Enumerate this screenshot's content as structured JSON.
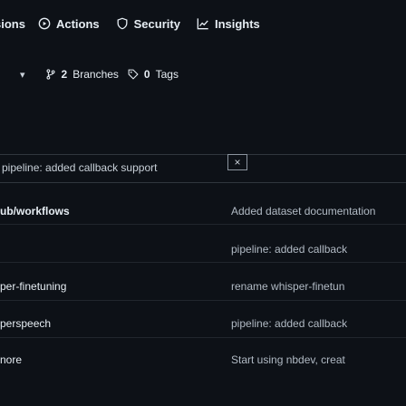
{
  "nav": {
    "items": [
      {
        "label": "sions",
        "icon": "discussions-icon"
      },
      {
        "label": "Actions",
        "icon": "play-circle-icon"
      },
      {
        "label": "Security",
        "icon": "shield-icon"
      },
      {
        "label": "Insights",
        "icon": "graph-icon"
      }
    ]
  },
  "branches": {
    "count": "2",
    "branches_label": "Branches",
    "tags_count": "0",
    "tags_label": "Tags"
  },
  "filter": {
    "commit_message": "pipeline: added callback support",
    "close_label": "×"
  },
  "files": [
    {
      "name": "ub/workflows",
      "message": "Added dataset documentation"
    },
    {
      "name": "",
      "message": "pipeline: added callback"
    },
    {
      "name": "per-finetuning",
      "message": "rename whisper-finetun"
    },
    {
      "name": "perspeech",
      "message": "pipeline: added callback"
    },
    {
      "name": "nore",
      "message": "Start using nbdev, creat"
    }
  ],
  "colors": {
    "background": "#0d1117",
    "text": "#e6edf3",
    "muted": "#b1bac4",
    "border": "#30363d"
  }
}
